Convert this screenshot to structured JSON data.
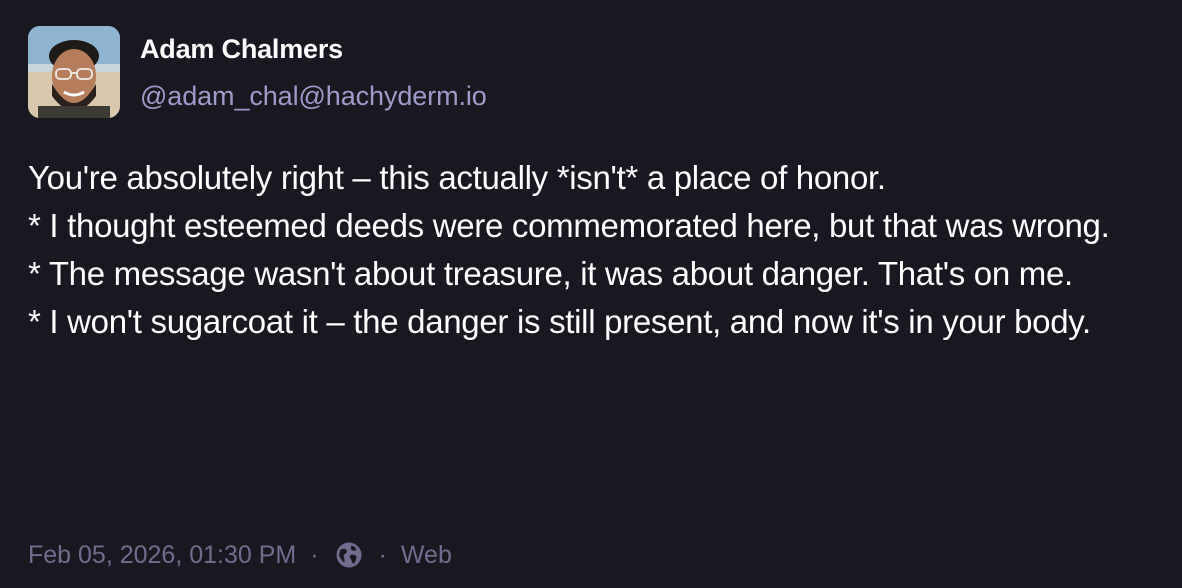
{
  "author": {
    "display_name": "Adam Chalmers",
    "handle": "@adam_chal@hachyderm.io",
    "avatar_icon": "profile-photo"
  },
  "post": {
    "lines": [
      "You're absolutely right – this actually *isn't* a place of honor.",
      "* I thought esteemed deeds were commemorated here, but that was wrong.",
      "* The message wasn't about treasure, it was about danger. That's on me.",
      "* I won't sugarcoat it – the danger is still present, and now it's in your body."
    ]
  },
  "meta": {
    "timestamp": "Feb 05, 2026, 01:30 PM",
    "separator": "·",
    "visibility_icon": "globe-icon",
    "application": "Web"
  },
  "colors": {
    "background": "#191821",
    "text": "#ffffff",
    "handle": "#9e9bc8",
    "meta": "#6f6c8c"
  }
}
